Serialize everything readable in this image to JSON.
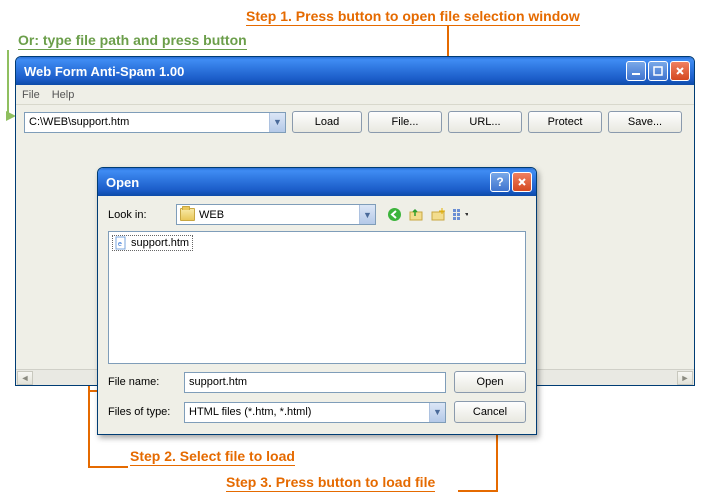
{
  "annotations": {
    "step1": "Step 1. Press button to open file selection window",
    "or": "Or: type file path and press button",
    "step2": "Step 2. Select file to load",
    "step3": "Step 3. Press button to load file"
  },
  "main": {
    "title": "Web Form Anti-Spam 1.00",
    "menu": {
      "file": "File",
      "help": "Help"
    },
    "path_value": "C:\\WEB\\support.htm",
    "buttons": {
      "load": "Load",
      "file": "File...",
      "url": "URL...",
      "protect": "Protect",
      "save": "Save..."
    }
  },
  "dialog": {
    "title": "Open",
    "lookin_label": "Look in:",
    "lookin_value": "WEB",
    "file_list": [
      {
        "name": "support.htm",
        "selected": true
      }
    ],
    "filename_label": "File name:",
    "filename_value": "support.htm",
    "filetype_label": "Files of type:",
    "filetype_value": "HTML files (*.htm, *.html)",
    "open_btn": "Open",
    "cancel_btn": "Cancel"
  }
}
